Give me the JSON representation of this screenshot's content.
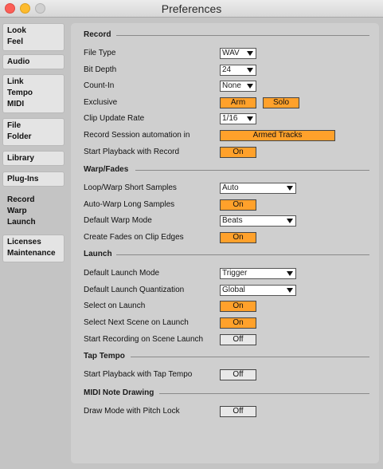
{
  "window": {
    "title": "Preferences"
  },
  "sidebar": {
    "tabs": [
      {
        "lines": [
          "Look",
          "Feel"
        ]
      },
      {
        "lines": [
          "Audio"
        ]
      },
      {
        "lines": [
          "Link",
          "Tempo",
          "MIDI"
        ]
      },
      {
        "lines": [
          "File",
          "Folder"
        ]
      },
      {
        "lines": [
          "Library"
        ]
      },
      {
        "lines": [
          "Plug-Ins"
        ]
      },
      {
        "lines": [
          "Record",
          "Warp",
          "Launch"
        ]
      },
      {
        "lines": [
          "Licenses",
          "Maintenance"
        ]
      }
    ]
  },
  "record": {
    "heading": "Record",
    "file_type": {
      "label": "File Type",
      "value": "WAV"
    },
    "bit_depth": {
      "label": "Bit Depth",
      "value": "24"
    },
    "count_in": {
      "label": "Count-In",
      "value": "None"
    },
    "exclusive": {
      "label": "Exclusive",
      "arm": "Arm",
      "solo": "Solo"
    },
    "clip_update_rate": {
      "label": "Clip Update Rate",
      "value": "1/16"
    },
    "session_automation": {
      "label": "Record Session automation in",
      "value": "Armed Tracks"
    },
    "start_playback": {
      "label": "Start Playback with Record",
      "value": "On"
    }
  },
  "warp": {
    "heading": "Warp/Fades",
    "loop_warp": {
      "label": "Loop/Warp Short Samples",
      "value": "Auto"
    },
    "auto_warp": {
      "label": "Auto-Warp Long Samples",
      "value": "On"
    },
    "default_mode": {
      "label": "Default Warp Mode",
      "value": "Beats"
    },
    "create_fades": {
      "label": "Create Fades on Clip Edges",
      "value": "On"
    }
  },
  "launch": {
    "heading": "Launch",
    "launch_mode": {
      "label": "Default Launch Mode",
      "value": "Trigger"
    },
    "launch_quant": {
      "label": "Default Launch Quantization",
      "value": "Global"
    },
    "select_on_launch": {
      "label": "Select on Launch",
      "value": "On"
    },
    "select_next_scene": {
      "label": "Select Next Scene on Launch",
      "value": "On"
    },
    "start_recording": {
      "label": "Start Recording on Scene Launch",
      "value": "Off"
    }
  },
  "tap_tempo": {
    "heading": "Tap Tempo",
    "start_playback": {
      "label": "Start Playback with Tap Tempo",
      "value": "Off"
    }
  },
  "midi_note": {
    "heading": "MIDI Note Drawing",
    "draw_mode": {
      "label": "Draw Mode with Pitch Lock",
      "value": "Off"
    }
  }
}
